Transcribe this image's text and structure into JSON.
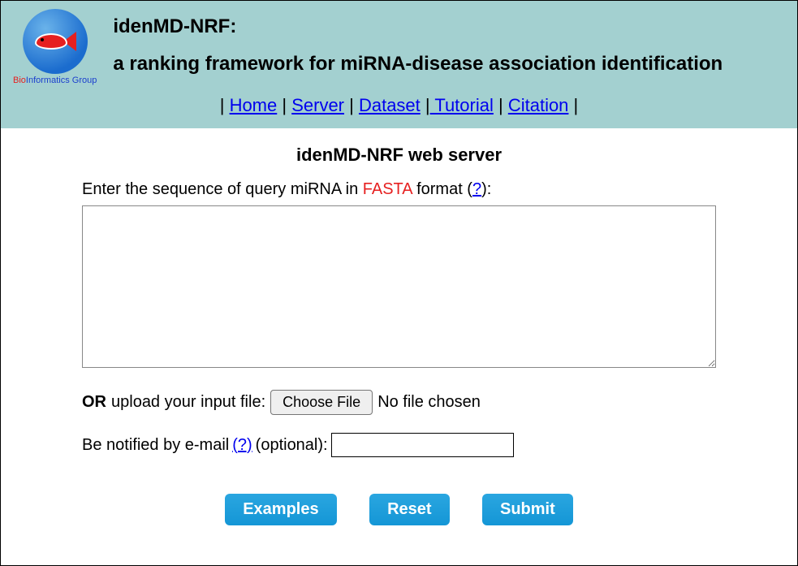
{
  "logo": {
    "text_bio": "Bio",
    "text_info": "Informatics",
    "text_group": " Group"
  },
  "header": {
    "title1": "idenMD-NRF:",
    "title2": "a ranking framework for miRNA-disease association identification"
  },
  "nav": {
    "home": "Home",
    "server": "Server",
    "dataset": "Dataset",
    "tutorial": " Tutorial",
    "citation": "Citation"
  },
  "main": {
    "page_title": "idenMD-NRF web server",
    "enter_prefix": "Enter the sequence of query miRNA in ",
    "fasta": "FASTA",
    "enter_mid": " format (",
    "help1": "?",
    "enter_suffix": "):",
    "textarea_value": "",
    "or": "OR",
    "upload_label": " upload your input file: ",
    "choose_file": "Choose File",
    "no_file": "No file chosen",
    "email_label_pre": "Be notified by e-mail ",
    "help2": "(?) ",
    "email_label_post": "(optional): ",
    "email_value": ""
  },
  "buttons": {
    "examples": "Examples",
    "reset": "Reset",
    "submit": "Submit"
  }
}
